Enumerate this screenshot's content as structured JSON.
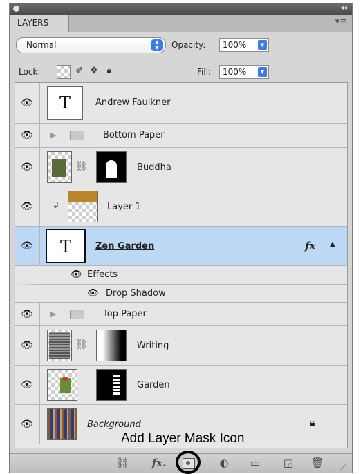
{
  "panel": {
    "tab_label": "LAYERS",
    "blend_mode": "Normal",
    "opacity_label": "Opacity:",
    "opacity_value": "100%",
    "lock_label": "Lock:",
    "fill_label": "Fill:",
    "fill_value": "100%"
  },
  "layers": [
    {
      "name": "Andrew Faulkner",
      "kind": "text",
      "thumb_letter": "T"
    },
    {
      "name": "Bottom Paper",
      "kind": "group"
    },
    {
      "name": "Buddha",
      "kind": "masked"
    },
    {
      "name": "Layer 1",
      "kind": "clipped"
    },
    {
      "name": "Zen Garden",
      "kind": "text",
      "thumb_letter": "T",
      "selected": true,
      "fx": "fx"
    },
    {
      "name": "Effects",
      "kind": "effects-header"
    },
    {
      "name": "Drop Shadow",
      "kind": "effect"
    },
    {
      "name": "Top Paper",
      "kind": "group"
    },
    {
      "name": "Writing",
      "kind": "masked"
    },
    {
      "name": "Garden",
      "kind": "masked"
    },
    {
      "name": "Background",
      "kind": "locked"
    }
  ],
  "annotation": "Add Layer Mask Icon",
  "bottom_bar": {
    "fx_label": "fx."
  },
  "colors": {
    "selected_row": "#bcd8f5",
    "panel_bg": "#d6d6d6",
    "accent": "#3b7de0"
  }
}
